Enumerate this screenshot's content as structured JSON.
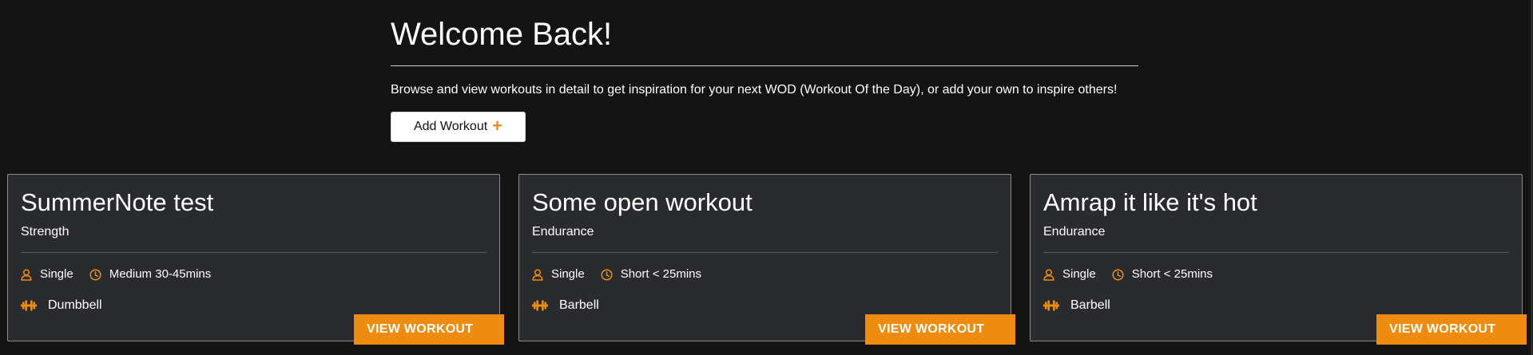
{
  "header": {
    "title": "Welcome Back!",
    "description": "Browse and view workouts in detail to get inspiration for your next WOD (Workout Of the Day), or add your own to inspire others!",
    "add_button_label": "Add Workout",
    "add_button_icon": "+"
  },
  "colors": {
    "background": "#141414",
    "card_background": "#2a2b2e",
    "accent": "#ef8c0f"
  },
  "cards": [
    {
      "title": "SummerNote test",
      "category": "Strength",
      "participants": "Single",
      "duration": "Medium 30-45mins",
      "equipment": "Dumbbell",
      "button_label": "VIEW WORKOUT"
    },
    {
      "title": "Some open workout",
      "category": "Endurance",
      "participants": "Single",
      "duration": "Short < 25mins",
      "equipment": "Barbell",
      "button_label": "VIEW WORKOUT"
    },
    {
      "title": "Amrap it like it's hot",
      "category": "Endurance",
      "participants": "Single",
      "duration": "Short < 25mins",
      "equipment": "Barbell",
      "button_label": "VIEW WORKOUT"
    }
  ],
  "icons": {
    "participants": "user-icon",
    "duration": "clock-icon",
    "equipment": "dumbbell-icon"
  }
}
